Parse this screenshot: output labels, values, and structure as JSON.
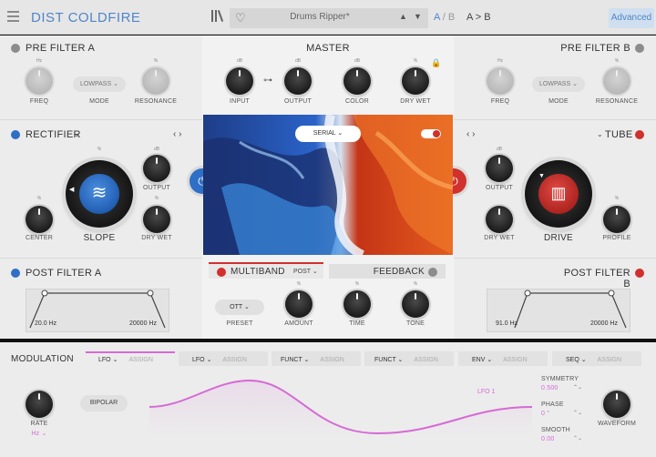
{
  "header": {
    "product": "DIST COLDFIRE",
    "preset_name": "Drums Ripper*",
    "ab_a": "A",
    "ab_sep": "/",
    "ab_b": "B",
    "a_to_b": "A > B",
    "advanced": "Advanced"
  },
  "pre_filter_a": {
    "title": "PRE FILTER A",
    "knob1": "FREQ",
    "knob2": "RESONANCE",
    "mode_value": "LOWPASS",
    "mode_label": "MODE",
    "tick1": "Hz",
    "tick2": "%"
  },
  "pre_filter_b": {
    "title": "PRE FILTER B",
    "knob1": "FREQ",
    "knob2": "RESONANCE",
    "mode_value": "LOWPASS",
    "mode_label": "MODE",
    "tick1": "Hz",
    "tick2": "%"
  },
  "master": {
    "title": "MASTER",
    "input": "INPUT",
    "output": "OUTPUT",
    "color": "COLOR",
    "dry_wet": "DRY WET",
    "t1": "dB",
    "t2": "dB",
    "t3": "dB",
    "t4": "%"
  },
  "rectifier": {
    "title": "RECTIFIER",
    "output": "OUTPUT",
    "center": "CENTER",
    "slope": "SLOPE",
    "dry_wet": "DRY WET",
    "t1": "%",
    "t2": "dB",
    "t3": "%",
    "t4": "%"
  },
  "tube": {
    "title": "TUBE",
    "output": "OUTPUT",
    "drive": "DRIVE",
    "dry_wet": "DRY WET",
    "profile": "PROFILE",
    "t1": "dB",
    "t2": "%",
    "t3": "%"
  },
  "post_filter_a": {
    "title": "POST FILTER A",
    "freq_low": "20.0 Hz",
    "freq_high": "20000 Hz"
  },
  "post_filter_b": {
    "title": "POST FILTER B",
    "freq_low": "91.0 Hz",
    "freq_high": "20000 Hz"
  },
  "routing": {
    "mode": "SERIAL"
  },
  "multiband": {
    "title": "MULTIBAND",
    "position": "POST",
    "feedback": "FEEDBACK",
    "preset_value": "OTT",
    "preset": "PRESET",
    "amount": "AMOUNT",
    "time": "TIME",
    "tone": "TONE",
    "t1": "%",
    "t2": "%",
    "t3": "%"
  },
  "modulation": {
    "title": "MODULATION",
    "tabs": [
      {
        "label": "LFO",
        "assign": "ASSIGN"
      },
      {
        "label": "LFO",
        "assign": "ASSIGN"
      },
      {
        "label": "FUNCT",
        "assign": "ASSIGN"
      },
      {
        "label": "FUNCT",
        "assign": "ASSIGN"
      },
      {
        "label": "ENV",
        "assign": "ASSIGN"
      },
      {
        "label": "SEQ",
        "assign": "ASSIGN"
      }
    ],
    "rate": "RATE",
    "rate_unit": "Hz",
    "bipolar": "BIPOLAR",
    "lfo_name": "LFO 1",
    "symmetry": "SYMMETRY",
    "symmetry_value": "0.500",
    "phase": "PHASE",
    "phase_value": "0 °",
    "smooth": "SMOOTH",
    "smooth_value": "0.00",
    "waveform": "WAVEFORM"
  },
  "colors": {
    "accent_blue": "#2f6fc5",
    "accent_red": "#d0312d",
    "lfo_pink": "#d66ad6"
  }
}
